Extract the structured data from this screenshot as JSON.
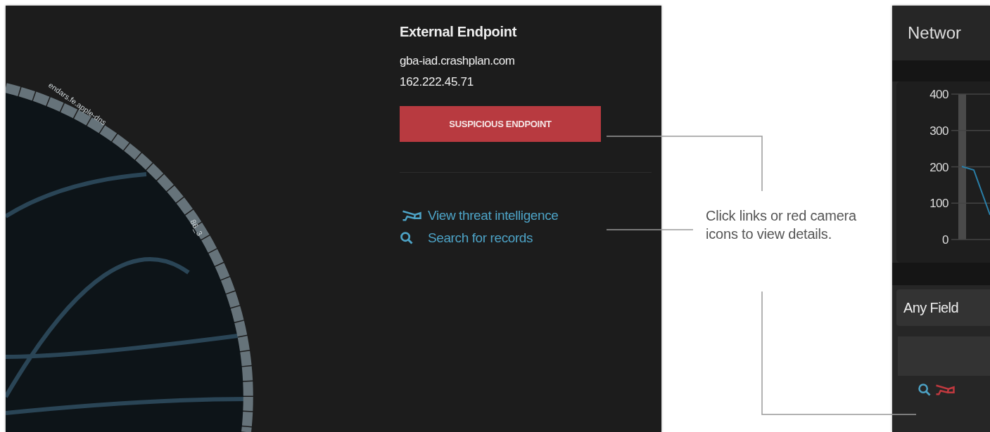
{
  "chord_diagram": {
    "labels": [
      "endars.fe.apple-dns",
      "86_3"
    ]
  },
  "endpoint_panel": {
    "title": "External Endpoint",
    "hostname": "gba-iad.crashplan.com",
    "ip": "162.222.45.71",
    "badge": "SUSPICIOUS ENDPOINT",
    "links": [
      {
        "kind": "camera",
        "label": "View threat intelligence"
      },
      {
        "kind": "search",
        "label": "Search for records"
      }
    ]
  },
  "callout": {
    "text": "Click links or red camera icons to view details."
  },
  "network_panel": {
    "title": "Networ",
    "chart": {
      "axis_labels": [
        "400",
        "300",
        "200",
        "100",
        "0"
      ]
    },
    "field": {
      "value": "Any Field"
    }
  }
}
